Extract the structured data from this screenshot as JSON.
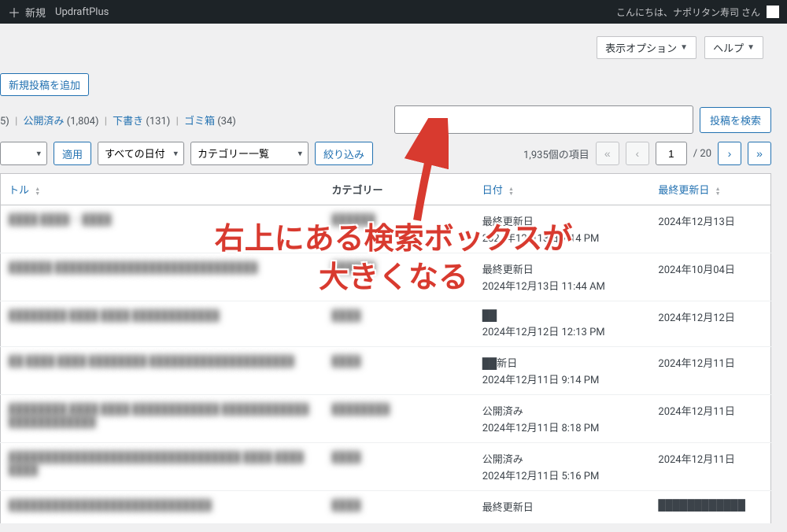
{
  "topbar": {
    "new_label": "新規",
    "updraft_label": "UpdraftPlus",
    "greeting": "こんにちは、ナポリタン寿司 さん"
  },
  "header": {
    "screen_options": "表示オプション",
    "help": "ヘルプ"
  },
  "add_new": "新規投稿を追加",
  "status_links": {
    "all_count": "5)",
    "published": "公開済み",
    "published_count": "(1,804)",
    "draft": "下書き",
    "draft_count": "(131)",
    "trash": "ゴミ箱",
    "trash_count": "(34)"
  },
  "search_button": "投稿を検索",
  "toolbar": {
    "apply": "適用",
    "all_dates": "すべての日付",
    "all_categories": "カテゴリー一覧",
    "filter": "絞り込み",
    "total_items": "1,935個の項目",
    "page_current": "1",
    "page_total": "/ 20"
  },
  "columns": {
    "title": "トル",
    "category": "カテゴリー",
    "date": "日付",
    "updated": "最終更新日"
  },
  "rows": [
    {
      "title": "████ ████ — ████",
      "cat": "██████",
      "status": "最終更新日",
      "datetime": "2024年12月13日 7:14 PM",
      "updated": "2024年12月13日"
    },
    {
      "title": "██████ ████████████████████████████",
      "cat": "██████",
      "status": "最終更新日",
      "datetime": "2024年12月13日 11:44 AM",
      "updated": "2024年10月04日"
    },
    {
      "title": "████████ ████ ████ ████████████",
      "cat": "████",
      "status": "██",
      "datetime": "2024年12月12日 12:13 PM",
      "updated": "2024年12月12日"
    },
    {
      "title": "██ ████ ████ ████████ ████████████████████",
      "cat": "████",
      "status": "██新日",
      "datetime": "2024年12月11日 9:14 PM",
      "updated": "2024年12月11日"
    },
    {
      "title": "████████ ████ ████ ████████████ ████████████ ████████████",
      "cat": "████████",
      "status": "公開済み",
      "datetime": "2024年12月11日 8:18 PM",
      "updated": "2024年12月11日"
    },
    {
      "title": "████████████████████████████████ ████ ████ ████",
      "cat": "████",
      "status": "公開済み",
      "datetime": "2024年12月11日 5:16 PM",
      "updated": "2024年12月11日"
    },
    {
      "title": "████████████████████████████",
      "cat": "████",
      "status": "最終更新日",
      "datetime": "",
      "updated": "████████████"
    }
  ],
  "annotation": {
    "line1": "右上にある検索ボックスが",
    "line2": "大きくなる"
  }
}
